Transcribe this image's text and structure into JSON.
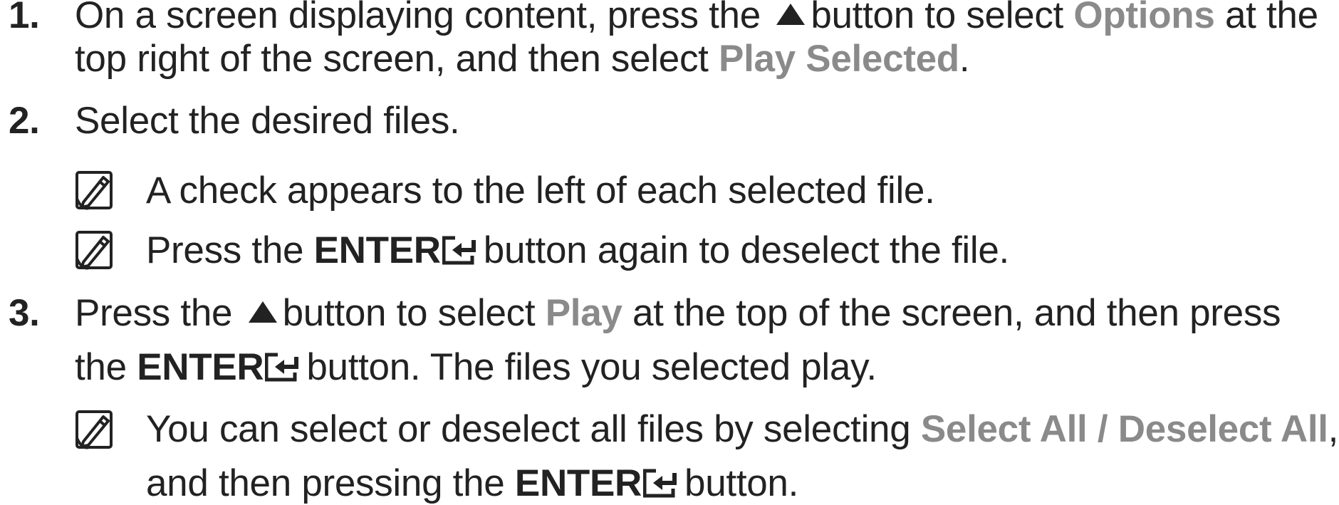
{
  "steps": [
    {
      "number": "1.",
      "line1": {
        "a": "On a screen displaying content, press the",
        "b": "button to select",
        "hl": "Options",
        "c": "at the"
      },
      "line2": {
        "a": "top right of the screen, and then select",
        "hl": "Play Selected",
        "c": "."
      }
    },
    {
      "number": "2.",
      "line1": {
        "a": "Select the desired files."
      },
      "notes": [
        {
          "text": "A check appears to the left of each selected file."
        },
        {
          "a": "Press the",
          "kw": "ENTER",
          "b": "button again to deselect the file."
        }
      ]
    },
    {
      "number": "3.",
      "line1": {
        "a": "Press the",
        "b": "button to select",
        "hl": "Play",
        "c": "at the top of the screen, and then press"
      },
      "line2": {
        "a": "the",
        "kw": "ENTER",
        "b": "button. The files you selected play."
      },
      "notes": [
        {
          "a": "You can select or deselect all files by selecting",
          "hl": "Select All / Deselect All",
          "b": ",",
          "line2a": "and then pressing the",
          "kw": "ENTER",
          "line2b": "button."
        }
      ]
    }
  ],
  "icons": {
    "up_button": "up-triangle-icon",
    "enter_button": "enter-icon",
    "note": "note-pencil-icon"
  },
  "colors": {
    "text": "#222222",
    "highlight": "#8a8a8a"
  }
}
